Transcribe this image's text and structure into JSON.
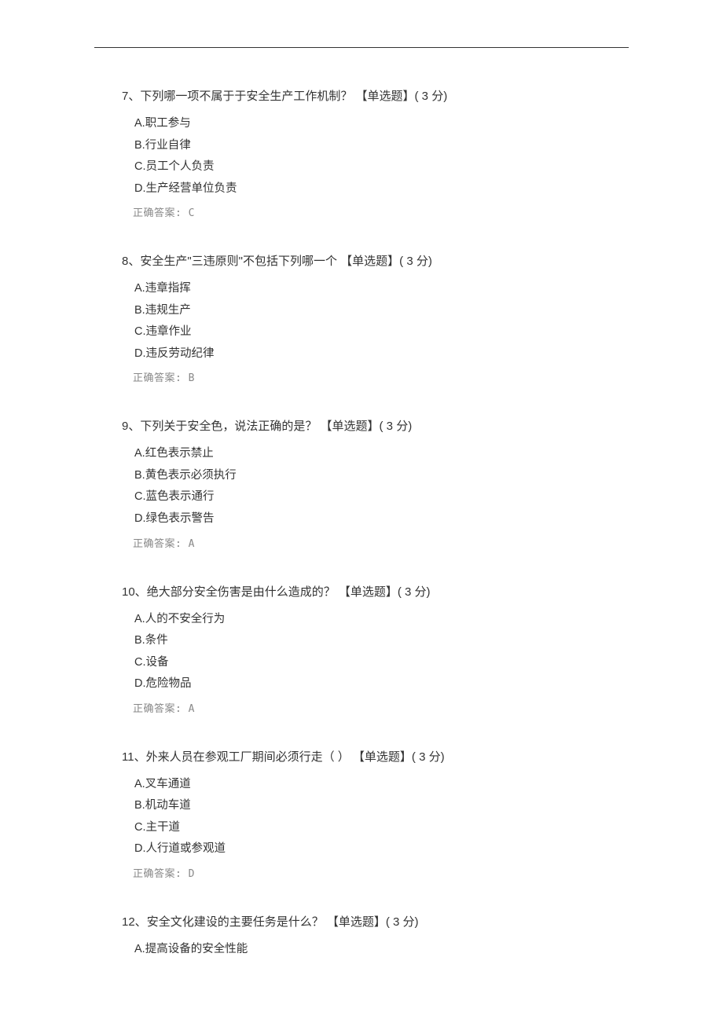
{
  "questions": [
    {
      "num": "7、",
      "text": "下列哪一项不属于于安全生产工作机制？ ",
      "tag": "【单选题】( 3 分)",
      "options": [
        {
          "letter": "A.",
          "text": "职工参与"
        },
        {
          "letter": "B.",
          "text": "行业自律"
        },
        {
          "letter": "C.",
          "text": "员工个人负责"
        },
        {
          "letter": "D.",
          "text": "生产经营单位负责"
        }
      ],
      "answer": "正确答案: C"
    },
    {
      "num": "8、",
      "text": "安全生产\"三违原则\"不包括下列哪一个 ",
      "tag": "【单选题】( 3 分)",
      "options": [
        {
          "letter": "A.",
          "text": "违章指挥"
        },
        {
          "letter": "B.",
          "text": "违规生产"
        },
        {
          "letter": "C.",
          "text": "违章作业"
        },
        {
          "letter": "D.",
          "text": "违反劳动纪律"
        }
      ],
      "answer": "正确答案: B"
    },
    {
      "num": "9、",
      "text": "下列关于安全色，说法正确的是？ ",
      "tag": "【单选题】( 3 分)",
      "options": [
        {
          "letter": "A.",
          "text": "红色表示禁止"
        },
        {
          "letter": "B.",
          "text": "黄色表示必须执行"
        },
        {
          "letter": "C.",
          "text": "蓝色表示通行"
        },
        {
          "letter": "D.",
          "text": "绿色表示警告"
        }
      ],
      "answer": "正确答案: A"
    },
    {
      "num": "10、",
      "text": "绝大部分安全伤害是由什么造成的？ ",
      "tag": "【单选题】( 3 分)",
      "options": [
        {
          "letter": "A.",
          "text": "人的不安全行为"
        },
        {
          "letter": "B.",
          "text": "条件"
        },
        {
          "letter": "C.",
          "text": "设备"
        },
        {
          "letter": "D.",
          "text": "危险物品"
        }
      ],
      "answer": "正确答案: A"
    },
    {
      "num": "11、",
      "text": "外来人员在参观工厂期间必须行走（ ） ",
      "tag": "【单选题】( 3 分)",
      "options": [
        {
          "letter": "A.",
          "text": "叉车通道"
        },
        {
          "letter": "B.",
          "text": "机动车道"
        },
        {
          "letter": "C.",
          "text": "主干道"
        },
        {
          "letter": "D.",
          "text": "人行道或参观道"
        }
      ],
      "answer": "正确答案: D"
    },
    {
      "num": "12、",
      "text": "安全文化建设的主要任务是什么？ ",
      "tag": "【单选题】( 3 分)",
      "options": [
        {
          "letter": "A.",
          "text": "提高设备的安全性能"
        }
      ],
      "answer": ""
    }
  ]
}
